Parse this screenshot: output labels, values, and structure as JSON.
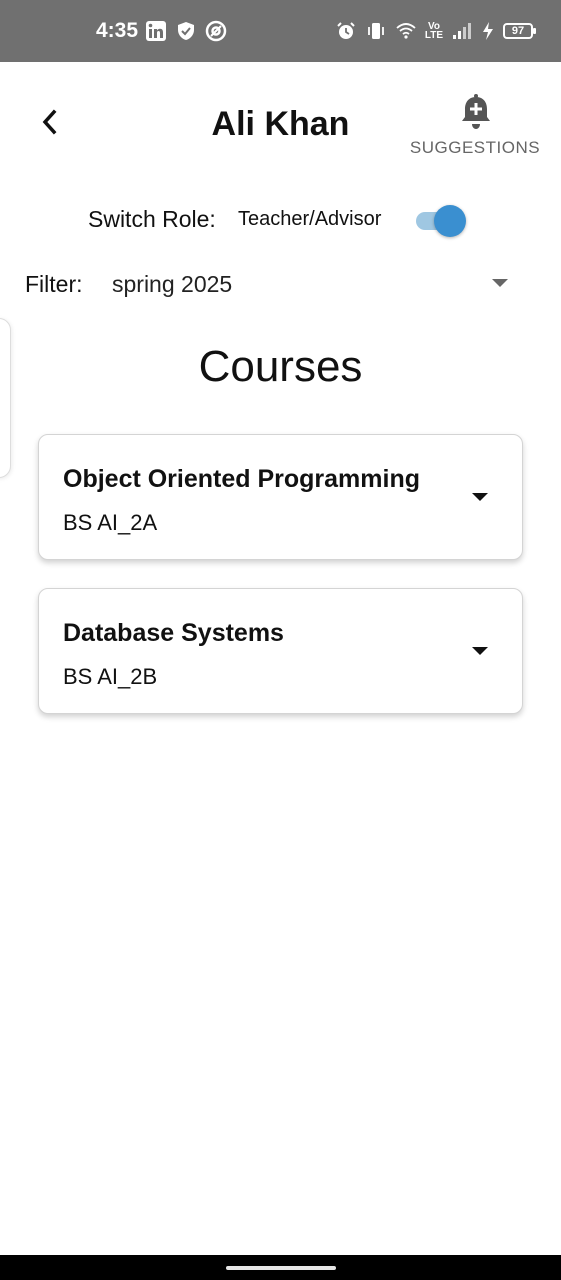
{
  "status_bar": {
    "time": "4:35",
    "battery": "97",
    "left_icons": [
      "linkedin-icon",
      "shield-check-icon",
      "at-sign-icon"
    ],
    "right_icons": [
      "alarm-icon",
      "vibrate-icon",
      "wifi-icon",
      "volte-icon",
      "signal-icon",
      "charging-icon"
    ]
  },
  "header": {
    "title": "Ali Khan",
    "suggestions_label": "SUGGESTIONS"
  },
  "switch_role": {
    "label": "Switch Role:",
    "value": "Teacher/Advisor",
    "enabled": true,
    "color": "#3a8fd0"
  },
  "filter": {
    "label": "Filter:",
    "selected": "spring 2025"
  },
  "courses": {
    "heading": "Courses",
    "items": [
      {
        "title": "Object Oriented Programming",
        "section": "BS AI_2A"
      },
      {
        "title": "Database Systems",
        "section": "BS AI_2B"
      }
    ]
  }
}
